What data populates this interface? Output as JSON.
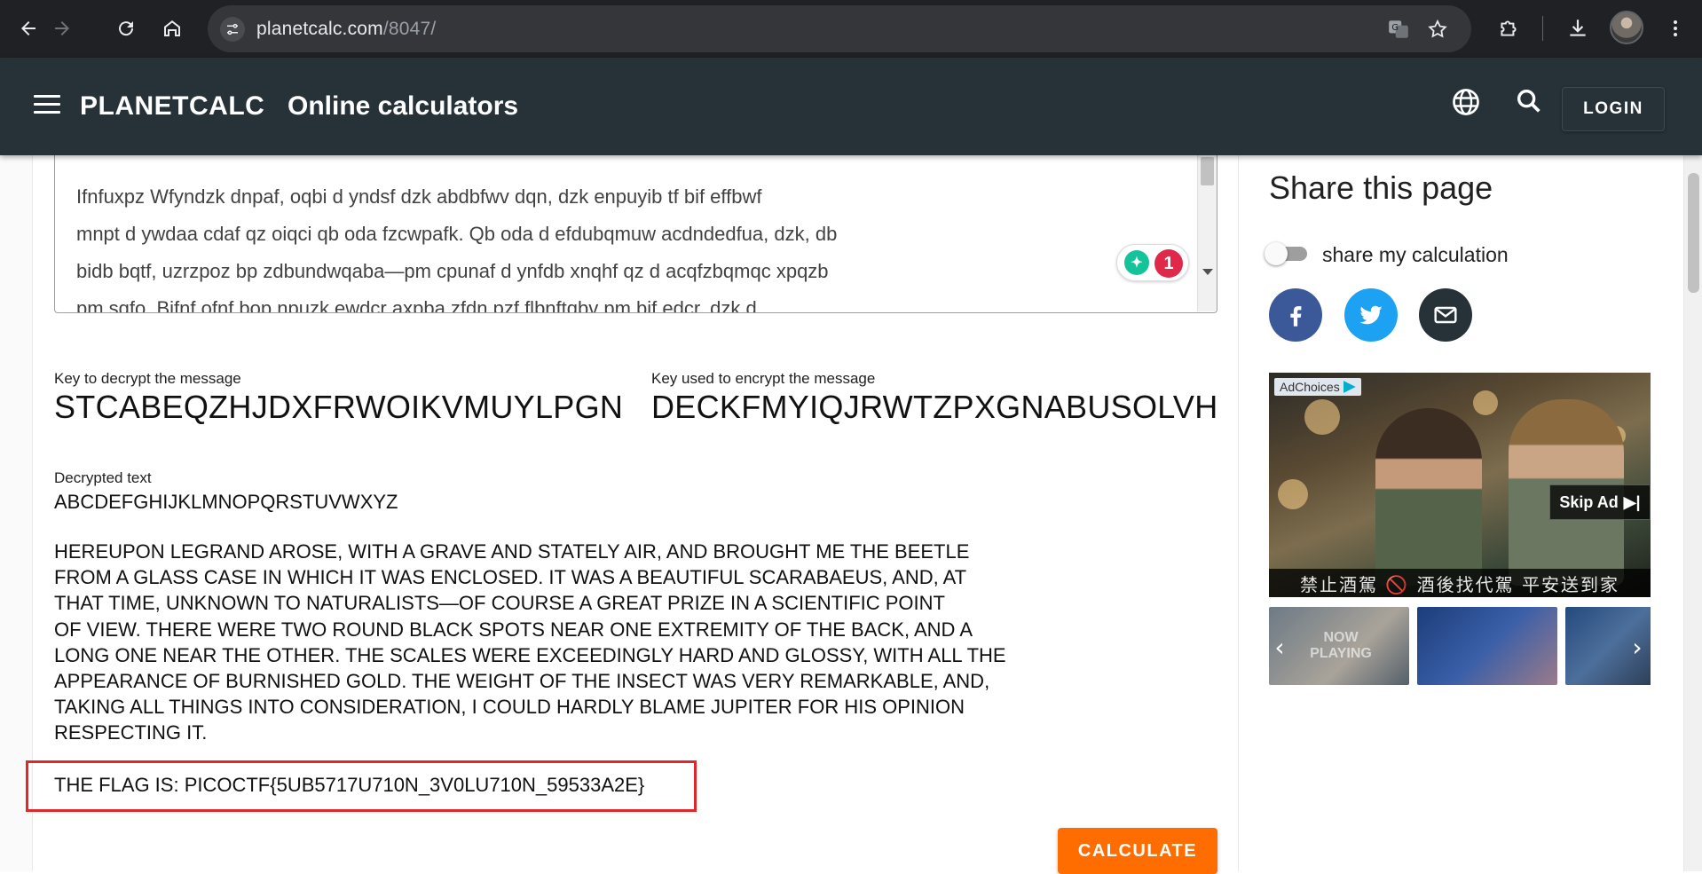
{
  "browser": {
    "url_host": "planetcalc.com",
    "url_path": "/8047/"
  },
  "site": {
    "brand": "PLANETCALC",
    "tagline": "Online calculators",
    "login_label": "LOGIN"
  },
  "calculator": {
    "ciphertext_lines": [
      "Ifnfuxpz Wfyndzk dnpaf, oqbi d yndsf dzk abdbfwv dqn, dzk enpuyib tf bif effbwf",
      "mnpt d ywdaa cdaf qz oiqci qb oda fzcwpafk. Qb oda d efdubqmuw acdndedfua, dzk, db",
      "bidb bqtf, uzrzpoz bp zdbundwqaba—pm cpunaf d ynfdb xnqhf qz d acqfzbqmqc xpqzb",
      "pm sqfo. Bifnf ofnf bop npuzk ewdcr axpba zfdn pzf flbnftqbv pm bif edcr, dzk d"
    ],
    "grammarly_count": "1",
    "decrypt_key_label": "Key to decrypt the message",
    "decrypt_key": "STCABEQZHJDXFRWOIKVMUYLPGN",
    "encrypt_key_label": "Key used to encrypt the message",
    "encrypt_key": "DECKFMYIQJRWTZPXGNABUSOLVH",
    "decrypted_label": "Decrypted text",
    "decrypted_alphabet": "ABCDEFGHIJKLMNOPQRSTUVWXYZ",
    "plaintext_lines": [
      "HEREUPON LEGRAND AROSE, WITH A GRAVE AND STATELY AIR, AND BROUGHT ME THE BEETLE",
      "FROM A GLASS CASE IN WHICH IT WAS ENCLOSED. IT WAS A BEAUTIFUL SCARABAEUS, AND, AT",
      "THAT TIME, UNKNOWN TO NATURALISTS—OF COURSE A GREAT PRIZE IN A SCIENTIFIC POINT",
      "OF VIEW. THERE WERE TWO ROUND BLACK SPOTS NEAR ONE EXTREMITY OF THE BACK, AND A",
      "LONG ONE NEAR THE OTHER. THE SCALES WERE EXCEEDINGLY HARD AND GLOSSY, WITH ALL THE",
      "APPEARANCE OF BURNISHED GOLD. THE WEIGHT OF THE INSECT WAS VERY REMARKABLE, AND,",
      "TAKING ALL THINGS INTO CONSIDERATION, I COULD HARDLY BLAME JUPITER FOR HIS OPINION",
      "RESPECTING IT."
    ],
    "flag_line": "THE FLAG IS: PICOCTF{5UB5717U710N_3V0LU710N_59533A2E}",
    "calculate_label": "CALCULATE"
  },
  "share": {
    "title": "Share this page",
    "toggle_label": "share my calculation"
  },
  "ad": {
    "adchoices_label": "AdChoices",
    "skip_label": "Skip Ad",
    "bottom_banner": "禁止酒駕 🚫 酒後找代駕 平安送到家",
    "thumb_caption": "NOW PLAYING"
  },
  "colors": {
    "header_bg": "#263238",
    "accent_button": "#ff6d00",
    "flag_box": "#e0272b",
    "facebook": "#3b5998",
    "twitter": "#1da1f2",
    "email": "#263238"
  }
}
